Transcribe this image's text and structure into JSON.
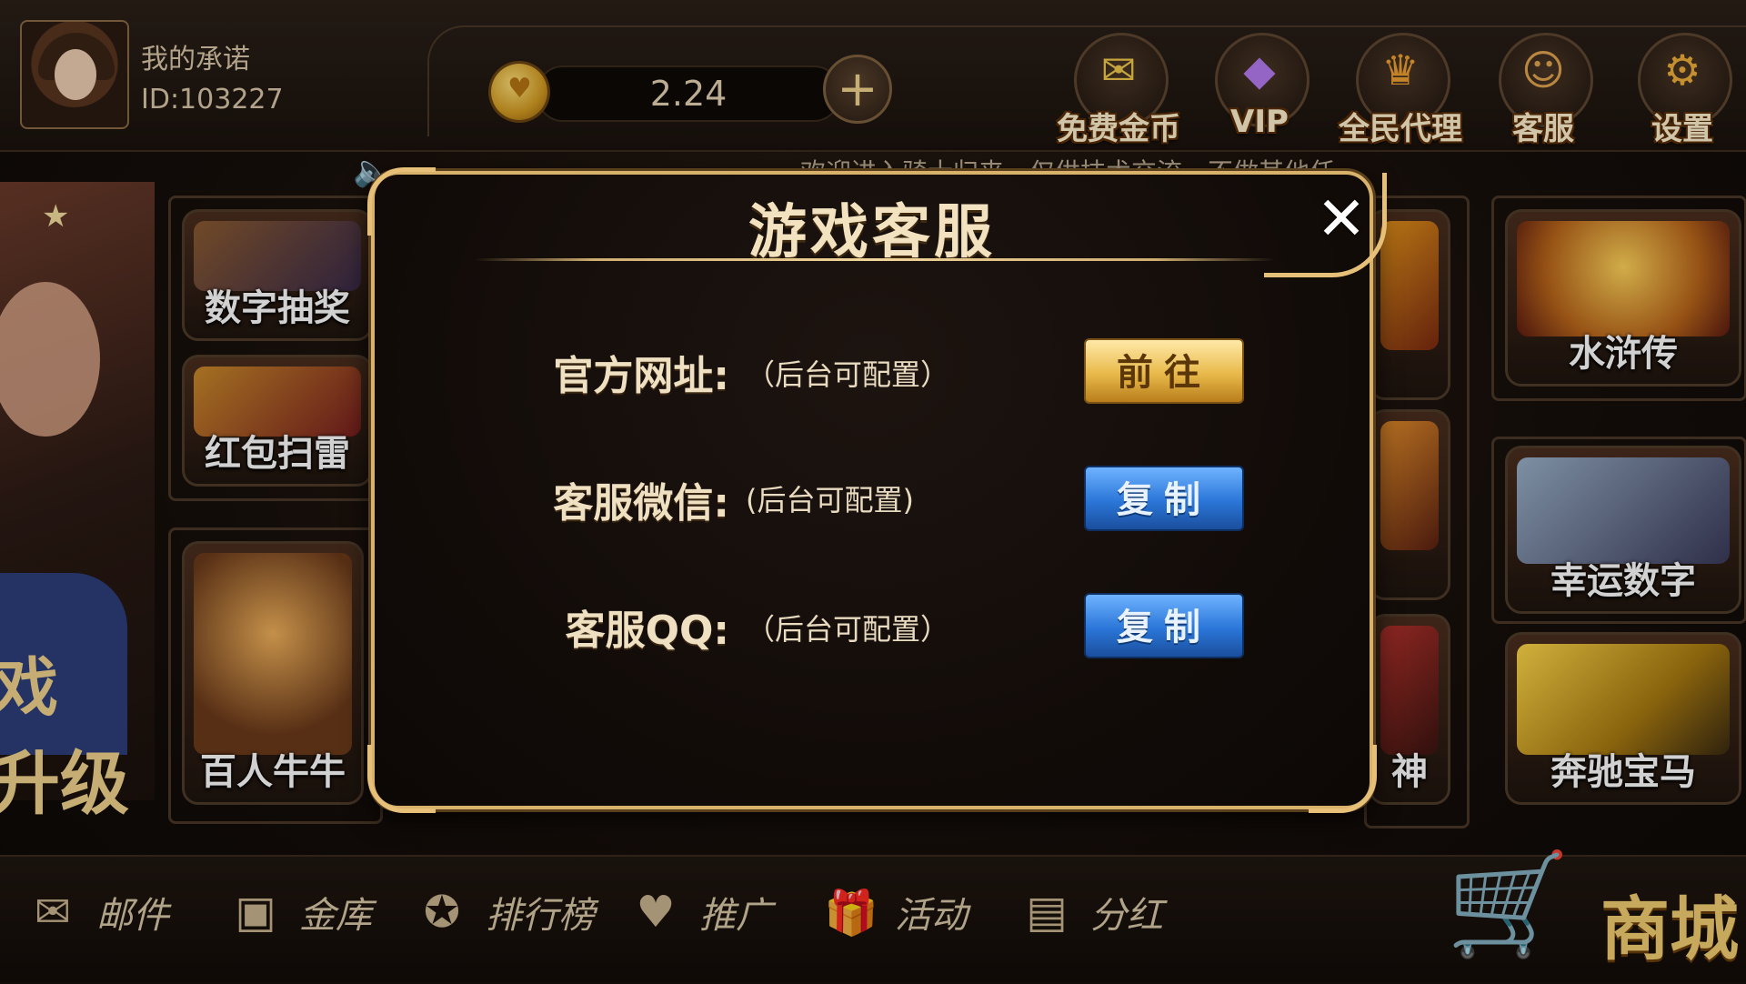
{
  "user": {
    "name": "我的承诺",
    "id": "ID:103227"
  },
  "balance": {
    "amount": "2.24",
    "add_label": "+"
  },
  "top_nav": [
    {
      "label": "免费金币",
      "icon": "coins-icon"
    },
    {
      "label": "VIP",
      "icon": "diamond-icon"
    },
    {
      "label": "全民代理",
      "icon": "crown-icon"
    },
    {
      "label": "客服",
      "icon": "support-icon"
    },
    {
      "label": "设置",
      "icon": "gear-icon"
    }
  ],
  "marquee": "欢迎进入骑士归来，仅供技术交流，不做其他任",
  "side_promo": {
    "line1": "戏",
    "line2": "升级"
  },
  "games_left": [
    {
      "label": "数字抽奖"
    },
    {
      "label": "红包扫雷"
    },
    {
      "label": "百人牛牛"
    }
  ],
  "games_mid": [
    {
      "label": ""
    },
    {
      "label": ""
    },
    {
      "label": "神"
    }
  ],
  "games_right": [
    {
      "label": "水浒传"
    },
    {
      "label": "幸运数字"
    },
    {
      "label": "奔驰宝马"
    }
  ],
  "bottom_nav": [
    {
      "label": "邮件",
      "icon": "mail-icon"
    },
    {
      "label": "金库",
      "icon": "safe-icon"
    },
    {
      "label": "排行榜",
      "icon": "medal-icon"
    },
    {
      "label": "推广",
      "icon": "handshake-icon"
    },
    {
      "label": "活动",
      "icon": "gift-icon"
    },
    {
      "label": "分红",
      "icon": "wallet-icon"
    }
  ],
  "shop_label": "商城",
  "dialog": {
    "title": "游戏客服",
    "close_label": "✕",
    "rows": [
      {
        "label": "官方网址:",
        "value": "（后台可配置）",
        "button": "前往"
      },
      {
        "label": "客服微信:",
        "value": "(后台可配置)",
        "button": "复制"
      },
      {
        "label": "客服QQ:",
        "value": "（后台可配置）",
        "button": "复制"
      }
    ]
  },
  "colors": {
    "gold_button": "#e8b94a",
    "blue_button": "#2a76d8",
    "frame_gold": "#d8b26a"
  }
}
